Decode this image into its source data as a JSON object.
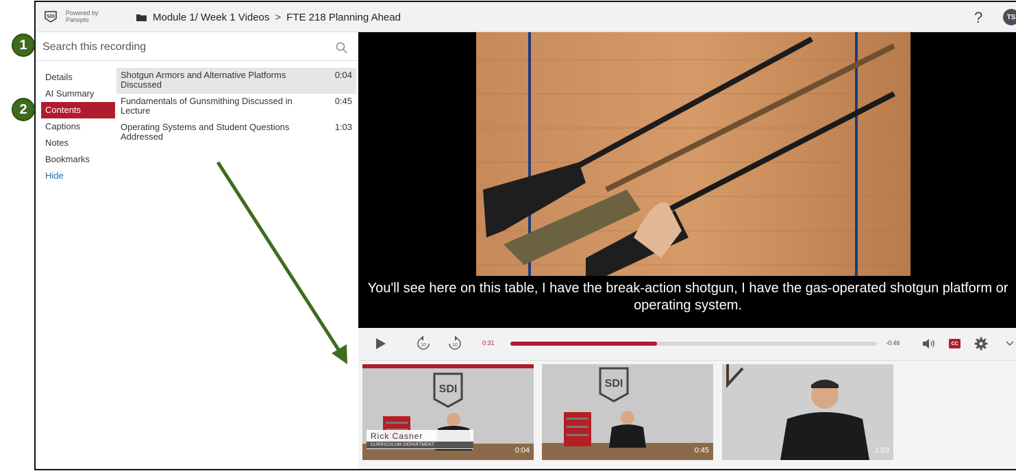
{
  "header": {
    "powered_line1": "Powered by",
    "powered_line2": "Panopto",
    "breadcrumb_folder": "Module 1/ Week 1 Videos",
    "breadcrumb_separator": ">",
    "breadcrumb_title": "FTE 218 Planning Ahead",
    "help_label": "?",
    "avatar_initials": "TS"
  },
  "search": {
    "placeholder": "Search this recording",
    "icon": "search-icon"
  },
  "sidebar": {
    "tabs": [
      {
        "label": "Details",
        "active": false
      },
      {
        "label": "AI Summary",
        "active": false
      },
      {
        "label": "Contents",
        "active": true
      },
      {
        "label": "Captions",
        "active": false
      },
      {
        "label": "Notes",
        "active": false
      },
      {
        "label": "Bookmarks",
        "active": false
      }
    ],
    "hide_label": "Hide"
  },
  "contents": [
    {
      "title": "Shotgun Armors and Alternative Platforms Discussed",
      "time": "0:04",
      "selected": true
    },
    {
      "title": "Fundamentals of Gunsmithing Discussed in Lecture",
      "time": "0:45",
      "selected": false
    },
    {
      "title": "Operating Systems and Student Questions Addressed",
      "time": "1:03",
      "selected": false
    }
  ],
  "video": {
    "caption": "You'll see here on this table, I have the break-action shotgun, I have the gas-operated shotgun platform or operating system."
  },
  "controls": {
    "current_time": "0:31",
    "remaining_time": "-0:46",
    "progress_fraction": 0.4,
    "cc_label": "CC",
    "rewind_label": "10",
    "forward_label": "10"
  },
  "thumbnails": [
    {
      "time": "0:04",
      "active": true,
      "name": "Rick Casner",
      "dept": "CURRICULUM DEPARTMENT"
    },
    {
      "time": "0:45",
      "active": false
    },
    {
      "time": "1:03",
      "active": false
    }
  ],
  "annotations": {
    "badge1": "1",
    "badge2": "2"
  },
  "colors": {
    "accent": "#b01c2e",
    "annotation": "#3f6b1e",
    "link": "#1a6fb0"
  }
}
